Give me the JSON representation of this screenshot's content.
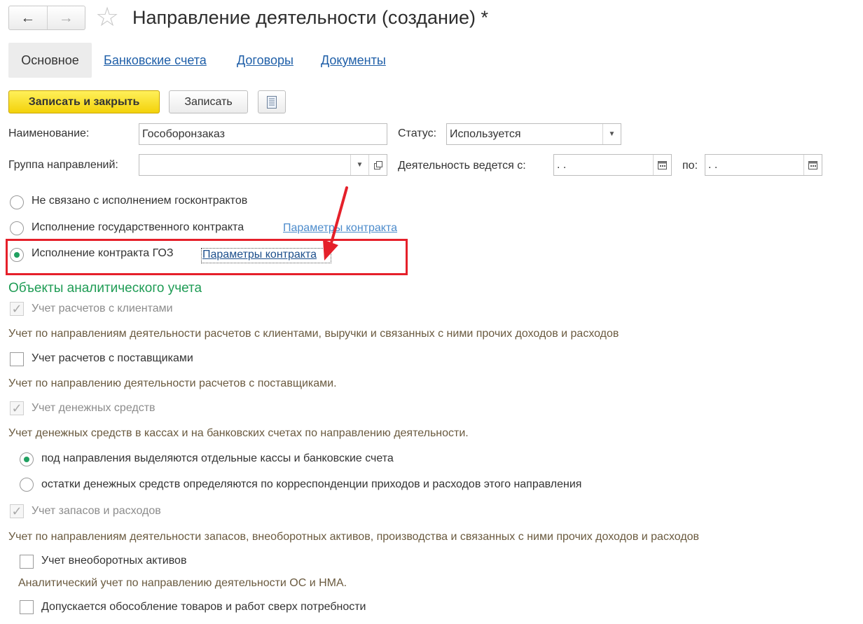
{
  "header": {
    "back_icon": "←",
    "forward_icon": "→",
    "title": "Направление деятельности (создание) *"
  },
  "tabs": [
    {
      "label": "Основное",
      "active": true
    },
    {
      "label": "Банковские счета",
      "active": false
    },
    {
      "label": "Договоры",
      "active": false
    },
    {
      "label": "Документы",
      "active": false
    }
  ],
  "toolbar": {
    "save_close_label": "Записать и закрыть",
    "save_label": "Записать",
    "more_icon": "list-icon"
  },
  "form": {
    "name_label": "Наименование:",
    "name_value": "Гособоронзаказ",
    "status_label": "Статус:",
    "status_value": "Используется",
    "group_label": "Группа направлений:",
    "group_value": "",
    "activity_from_label": "Деятельность ведется с:",
    "activity_from_value": " .  .",
    "activity_to_label": "по:",
    "activity_to_value": " .  ."
  },
  "contract_options": [
    {
      "label": "Не связано с исполнением госконтрактов",
      "selected": false
    },
    {
      "label": "Исполнение государственного контракта",
      "selected": false,
      "link": "Параметры контракта"
    },
    {
      "label": "Исполнение контракта ГОЗ",
      "selected": true,
      "link": "Параметры контракта"
    }
  ],
  "analytics": {
    "title": "Объекты аналитического учета",
    "clients_label": "Учет расчетов с клиентами",
    "clients_desc": "Учет по направлениям деятельности расчетов с клиентами, выручки и связанных с ними прочих доходов и расходов",
    "suppliers_label": "Учет расчетов с поставщиками",
    "suppliers_desc": "Учет по направлению деятельности расчетов с поставщиками.",
    "cash_label": "Учет денежных средств",
    "cash_desc": "Учет денежных средств в кассах и на банковских счетах по направлению деятельности.",
    "cash_options": [
      {
        "label": "под направления выделяются отдельные кассы и банковские счета",
        "selected": true
      },
      {
        "label": "остатки денежных средств определяются по корреспонденции приходов и расходов этого направления",
        "selected": false
      }
    ],
    "stock_label": "Учет запасов и расходов",
    "stock_desc": "Учет по направлениям деятельности запасов, внеоборотных активов, производства и связанных с ними прочих доходов и расходов",
    "fixed_assets_label": "Учет внеоборотных активов",
    "fixed_assets_desc": "Аналитический учет по направлению деятельности ОС и НМА.",
    "isolation_label": "Допускается обособление товаров и работ сверх потребности"
  },
  "colors": {
    "accent_yellow": "#f3d20a",
    "section_green": "#1f9c55",
    "highlight_red": "#e5202a",
    "link_blue": "#1f5fa8"
  }
}
